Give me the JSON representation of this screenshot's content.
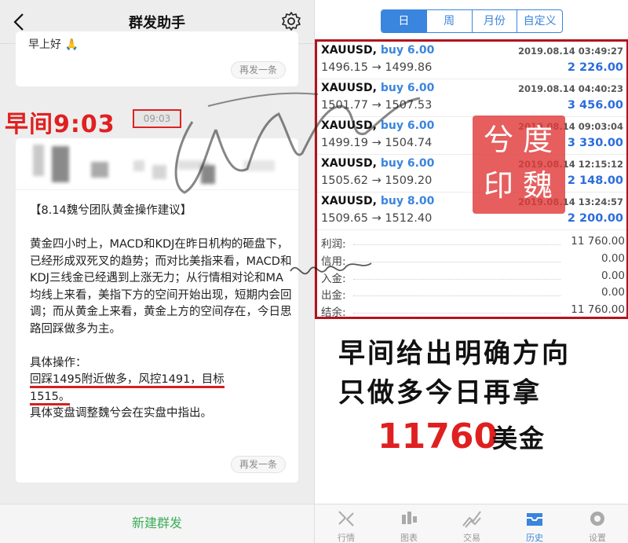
{
  "chat": {
    "title": "群发助手",
    "prev_partial": "早上好 🙏",
    "resend_label": "再发一条",
    "time_label": "早间9:03",
    "time_box": "09:03",
    "message": {
      "heading": "【8.14魏兮团队黄金操作建议】",
      "para1": "黄金四小时上，MACD和KDJ在昨日机构的砸盘下，已经形成双死叉的趋势；而对比美指来看，MACD和KDJ三线金已经遇到上涨无力；从行情相对论和MA均线上来看，美指下方的空间开始出现，短期内会回调；而从黄金上来看，黄金上方的空间存在，今日思路回踩做多为主。",
      "ops_title": "具体操作：",
      "ops_line1": "回踩1495附近做多，风控1491，目标",
      "ops_line2": "1515。",
      "ops_note": "具体变盘调整魏兮会在实盘中指出。"
    },
    "footer": "新建群发"
  },
  "trading": {
    "tabs": [
      "日",
      "周",
      "月份",
      "自定义"
    ],
    "active_tab": 0,
    "trades": [
      {
        "symbol": "XAUUSD,",
        "side": "buy 6.00",
        "date": "2019.08.14 03:49:27",
        "prices": "1496.15 → 1499.86",
        "profit": "2 226.00"
      },
      {
        "symbol": "XAUUSD,",
        "side": "buy 6.00",
        "date": "2019.08.14 04:40:23",
        "prices": "1501.77 → 1507.53",
        "profit": "3 456.00"
      },
      {
        "symbol": "XAUUSD,",
        "side": "buy 6.00",
        "date": "2019.08.14 09:03:04",
        "prices": "1499.19 → 1504.74",
        "profit": "3 330.00"
      },
      {
        "symbol": "XAUUSD,",
        "side": "buy 6.00",
        "date": "2019.08.14 12:15:12",
        "prices": "1505.62 → 1509.20",
        "profit": "2 148.00"
      },
      {
        "symbol": "XAUUSD,",
        "side": "buy 8.00",
        "date": "2019.08.14 13:24:57",
        "prices": "1509.65 → 1512.40",
        "profit": "2 200.00"
      }
    ],
    "summary": [
      {
        "label": "利润:",
        "value": "11 760.00"
      },
      {
        "label": "信用:",
        "value": "0.00"
      },
      {
        "label": "入金:",
        "value": "0.00"
      },
      {
        "label": "出金:",
        "value": "0.00"
      },
      {
        "label": "结余:",
        "value": "11 760.00"
      }
    ],
    "stamp": [
      "兮",
      "度",
      "印",
      "魏"
    ],
    "headline1": "早间给出明确方向",
    "headline2": "只做多今日再拿",
    "amount": "11760",
    "amount_unit": "美金",
    "tabbar": [
      {
        "label": "行情",
        "icon": "quotes-icon"
      },
      {
        "label": "图表",
        "icon": "chart-icon"
      },
      {
        "label": "交易",
        "icon": "trade-icon"
      },
      {
        "label": "历史",
        "icon": "history-icon"
      },
      {
        "label": "设置",
        "icon": "settings-icon"
      }
    ],
    "active_tabbar": 3
  },
  "colors": {
    "accent_blue": "#3a85de",
    "highlight_red": "#e02020",
    "chat_green": "#3eae5c"
  }
}
